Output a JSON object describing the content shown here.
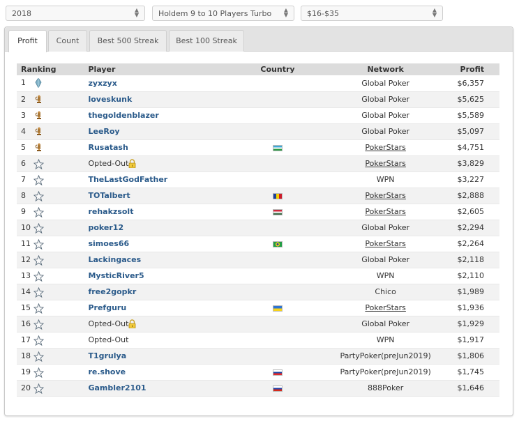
{
  "filters": {
    "year": "2018",
    "game_type": "Holdem 9 to 10 Players Turbo",
    "stake": "$16-$35"
  },
  "tabs": [
    {
      "label": "Profit",
      "active": true
    },
    {
      "label": "Count",
      "active": false
    },
    {
      "label": "Best 500 Streak",
      "active": false
    },
    {
      "label": "Best 100 Streak",
      "active": false
    }
  ],
  "table": {
    "headers": {
      "ranking": "Ranking",
      "player": "Player",
      "country": "Country",
      "network": "Network",
      "profit": "Profit"
    },
    "rows": [
      {
        "rank": "1",
        "icon": "diamond-icon",
        "player": "zyxzyx",
        "opted_out": false,
        "flag": "",
        "network": "Global Poker",
        "network_link": false,
        "profit": "$6,357"
      },
      {
        "rank": "2",
        "icon": "trophy-icon",
        "player": "loveskunk",
        "opted_out": false,
        "flag": "",
        "network": "Global Poker",
        "network_link": false,
        "profit": "$5,625"
      },
      {
        "rank": "3",
        "icon": "trophy-icon",
        "player": "thegoldenblazer",
        "opted_out": false,
        "flag": "",
        "network": "Global Poker",
        "network_link": false,
        "profit": "$5,589"
      },
      {
        "rank": "4",
        "icon": "trophy-icon",
        "player": "LeeRoy",
        "opted_out": false,
        "flag": "",
        "network": "Global Poker",
        "network_link": false,
        "profit": "$5,097"
      },
      {
        "rank": "5",
        "icon": "trophy-icon",
        "player": "Rusatash",
        "opted_out": false,
        "flag": "uz-flag",
        "network": "PokerStars",
        "network_link": true,
        "profit": "$4,751"
      },
      {
        "rank": "6",
        "icon": "star-icon",
        "player": "Opted-Out",
        "opted_out": true,
        "flag": "",
        "network": "PokerStars",
        "network_link": true,
        "profit": "$3,829"
      },
      {
        "rank": "7",
        "icon": "star-icon",
        "player": "TheLastGodFather",
        "opted_out": false,
        "flag": "",
        "network": "WPN",
        "network_link": false,
        "profit": "$3,227"
      },
      {
        "rank": "8",
        "icon": "star-icon",
        "player": "TOTalbert",
        "opted_out": false,
        "flag": "ro-flag",
        "network": "PokerStars",
        "network_link": true,
        "profit": "$2,888"
      },
      {
        "rank": "9",
        "icon": "star-icon",
        "player": "rehakzsolt",
        "opted_out": false,
        "flag": "hu-flag",
        "network": "PokerStars",
        "network_link": true,
        "profit": "$2,605"
      },
      {
        "rank": "10",
        "icon": "star-icon",
        "player": "poker12",
        "opted_out": false,
        "flag": "",
        "network": "Global Poker",
        "network_link": false,
        "profit": "$2,294"
      },
      {
        "rank": "11",
        "icon": "star-icon",
        "player": "simoes66",
        "opted_out": false,
        "flag": "br-flag",
        "network": "PokerStars",
        "network_link": true,
        "profit": "$2,264"
      },
      {
        "rank": "12",
        "icon": "star-icon",
        "player": "Lackingaces",
        "opted_out": false,
        "flag": "",
        "network": "Global Poker",
        "network_link": false,
        "profit": "$2,118"
      },
      {
        "rank": "13",
        "icon": "star-icon",
        "player": "MysticRiver5",
        "opted_out": false,
        "flag": "",
        "network": "WPN",
        "network_link": false,
        "profit": "$2,110"
      },
      {
        "rank": "14",
        "icon": "star-icon",
        "player": "free2gopkr",
        "opted_out": false,
        "flag": "",
        "network": "Chico",
        "network_link": false,
        "profit": "$1,989"
      },
      {
        "rank": "15",
        "icon": "star-icon",
        "player": "Prefguru",
        "opted_out": false,
        "flag": "ua-flag",
        "network": "PokerStars",
        "network_link": true,
        "profit": "$1,936"
      },
      {
        "rank": "16",
        "icon": "star-icon",
        "player": "Opted-Out",
        "opted_out": true,
        "flag": "",
        "network": "Global Poker",
        "network_link": false,
        "profit": "$1,929"
      },
      {
        "rank": "17",
        "icon": "star-icon",
        "player": "Opted-Out",
        "opted_out": true,
        "flag": "",
        "network": "WPN",
        "network_link": false,
        "profit": "$1,917"
      },
      {
        "rank": "18",
        "icon": "star-icon",
        "player": "T1grulya",
        "opted_out": false,
        "flag": "",
        "network": "PartyPoker(preJun2019)",
        "network_link": false,
        "profit": "$1,806"
      },
      {
        "rank": "19",
        "icon": "star-icon",
        "player": "re.shove",
        "opted_out": false,
        "flag": "sk-flag",
        "network": "PartyPoker(preJun2019)",
        "network_link": false,
        "profit": "$1,745"
      },
      {
        "rank": "20",
        "icon": "star-icon",
        "player": "Gambler2101",
        "opted_out": false,
        "flag": "ru-flag",
        "network": "888Poker",
        "network_link": false,
        "profit": "$1,646"
      }
    ]
  },
  "colors": {
    "player_link": "#2a5a8a",
    "header_bg": "#dcdcdc",
    "tabbar_bg": "#e3e3e3"
  }
}
